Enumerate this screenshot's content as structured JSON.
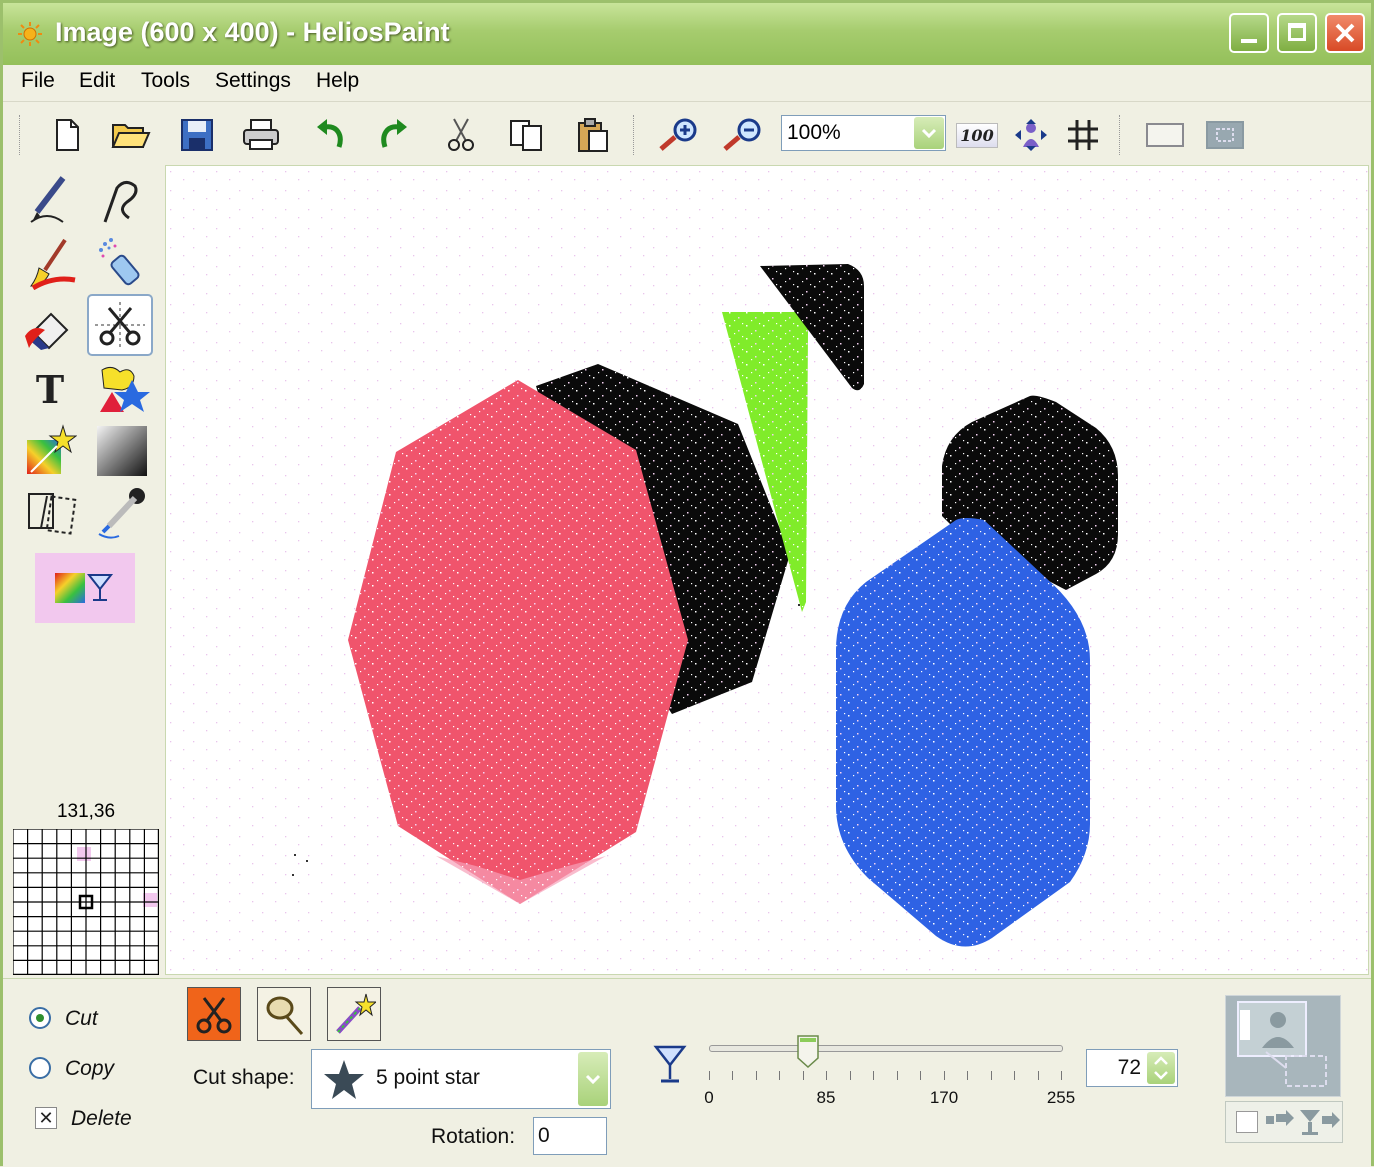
{
  "window": {
    "title": "Image (600 x 400) - HeliosPaint",
    "controls": [
      "minimize",
      "maximize",
      "close"
    ]
  },
  "menu": [
    "File",
    "Edit",
    "Tools",
    "Settings",
    "Help"
  ],
  "toolbar": {
    "buttons": [
      "new-icon",
      "open-icon",
      "save-icon",
      "print-icon",
      "undo-icon",
      "redo-icon",
      "cut-icon",
      "copy-icon",
      "paste-icon",
      "zoom-in-icon",
      "zoom-out-icon"
    ],
    "zoom_value": "100%",
    "actual_size_label": "100",
    "extra_buttons": [
      "fit-window-icon",
      "grid-icon",
      "select-rectangle-icon",
      "select-fullscreen-icon"
    ]
  },
  "tools": {
    "items": [
      "pencil-icon",
      "curve-icon",
      "brush-icon",
      "spray-can-icon",
      "eraser-icon",
      "cut-selection-icon",
      "text-icon",
      "shapes-icon",
      "magic-effects-icon",
      "gradient-icon",
      "transform-icon",
      "color-picker-icon"
    ],
    "selected": "cut-selection-icon",
    "color_button": "color-transparency-icon"
  },
  "status": {
    "coordinates": "131,36"
  },
  "canvas": {
    "colors": {
      "red_shape": "#f0546c",
      "black_shape": "#0a0a0a",
      "green_shape": "#80ec2a",
      "blue_shape": "#2e62e4"
    }
  },
  "options": {
    "mode_cut": "Cut",
    "mode_copy": "Copy",
    "delete_label": "Delete",
    "selected_mode": "Cut",
    "delete_checked": true,
    "cut_shape_label": "Cut shape:",
    "cut_shape_value": "5 point star",
    "rotation_label": "Rotation:",
    "rotation_value": "0",
    "slider": {
      "value": 72,
      "min": 0,
      "max": 255,
      "tick_labels": [
        "0",
        "85",
        "170",
        "255"
      ]
    },
    "tolerance_value": "72",
    "accent_color": "#f0641a"
  }
}
